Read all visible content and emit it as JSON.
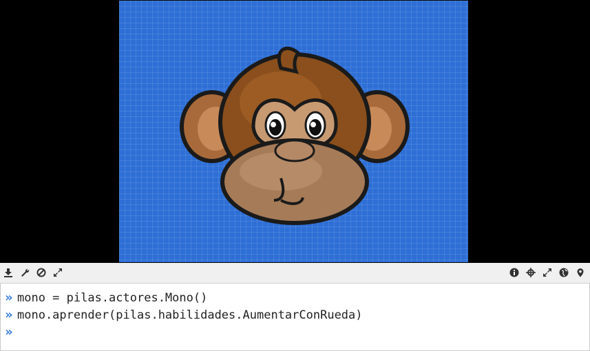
{
  "toolbar": {
    "left_icons": [
      "download-icon",
      "wrench-icon",
      "block-icon",
      "expand-icon"
    ],
    "right_icons": [
      "info-icon",
      "crosshair-icon",
      "expand-icon",
      "globe-icon",
      "location-pin-icon"
    ]
  },
  "console": {
    "prompt_symbol": "»",
    "lines": [
      "mono = pilas.actores.Mono()",
      "mono.aprender(pilas.habilidades.AumentarConRueda)",
      ""
    ]
  },
  "colors": {
    "canvas_background": "#2e6fd6",
    "prompt": "#3b7ddd",
    "stage_background": "#000000"
  }
}
